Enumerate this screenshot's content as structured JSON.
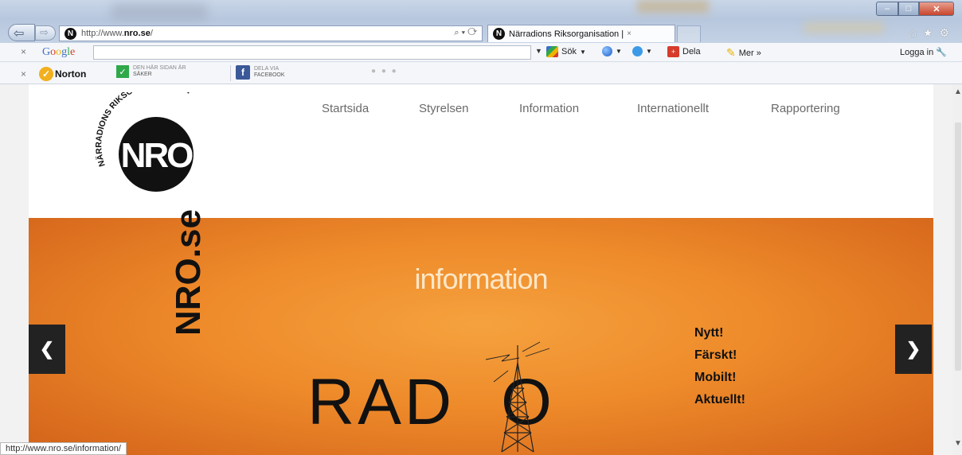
{
  "browser": {
    "url_prefix": "http://www.",
    "url_domain": "nro.se",
    "url_suffix": "/",
    "address_tools": "⌕ ▾ ⟳",
    "favicon_letter": "N",
    "tab_title": "Närradions Riksorganisation |",
    "tab_close": "×",
    "status_url": "http://www.nro.se/information/"
  },
  "google_toolbar": {
    "close": "×",
    "logo": "Google",
    "search_value": "",
    "sok_label": "Sök",
    "dela_label": "Dela",
    "mer_label": "Mer »",
    "login_label": "Logga in"
  },
  "norton_toolbar": {
    "close": "×",
    "norton_label": "Norton",
    "safe_line1": "DEN HÄR SIDAN ÄR",
    "safe_line2": "SÄKER",
    "fb_line1": "DELA VIA",
    "fb_line2": "FACEBOOK"
  },
  "site": {
    "logo_text": "NRO",
    "logo_ring_text": "NÄRRADIONS RIKSORGANISATION",
    "nav": [
      "Startsida",
      "Styrelsen",
      "Information",
      "Internationellt",
      "Rapportering"
    ],
    "hero": {
      "title": "information",
      "vertical_text": "NRO.se",
      "radio_left": "RAD",
      "radio_right": "O",
      "tags": [
        "Nytt!",
        "Färskt!",
        "Mobilt!",
        "Aktuellt!"
      ],
      "prev_arrow": "❮",
      "next_arrow": "❯"
    }
  },
  "colors": {
    "hero_orange": "#ee8a2a",
    "nav_text": "#6a6a6a",
    "logo_black": "#111111"
  }
}
